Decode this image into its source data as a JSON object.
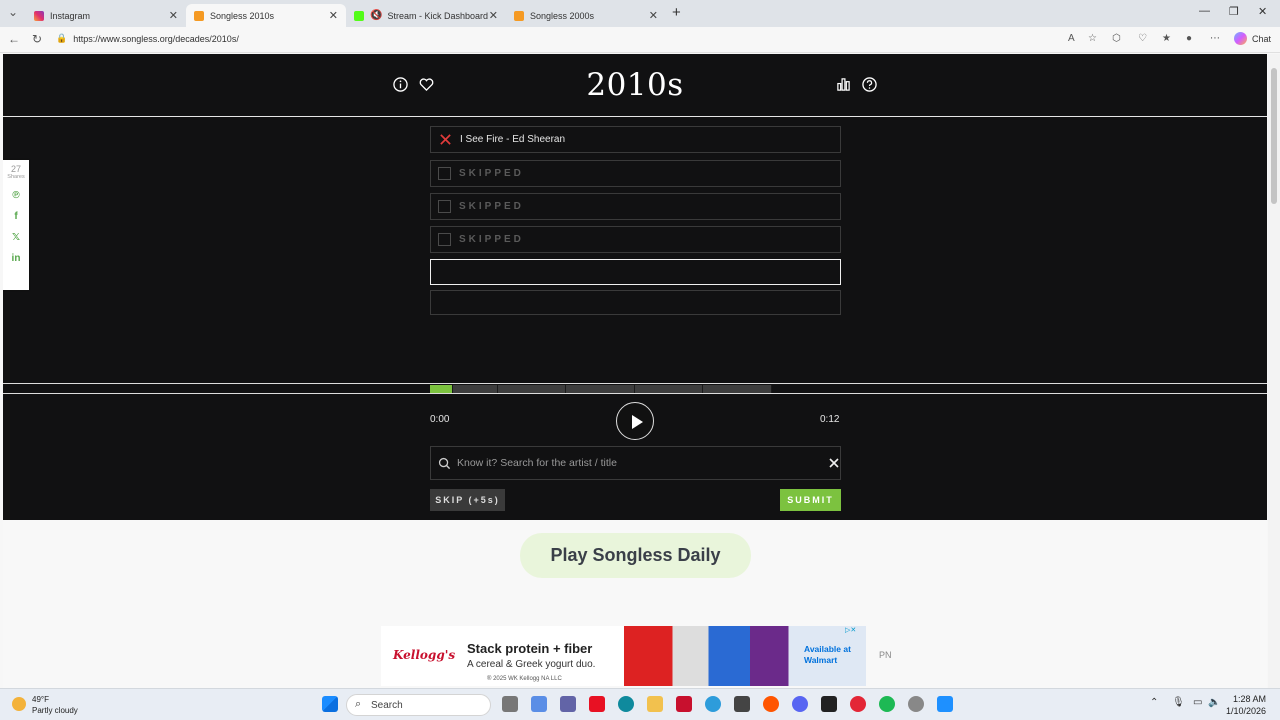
{
  "browser": {
    "tabs": [
      {
        "label": "Instagram",
        "color": "#e1306c"
      },
      {
        "label": "Songless 2010s",
        "color": "#f59a23",
        "active": true
      },
      {
        "label": "Stream - Kick Dashboard",
        "color": "#53fc18"
      },
      {
        "label": "Songless 2000s",
        "color": "#f59a23"
      }
    ],
    "url": "https://www.songless.org/decades/2010s/",
    "chat_label": "Chat"
  },
  "game": {
    "title": "2010s",
    "guesses": [
      {
        "state": "wrong",
        "text": "I See Fire - Ed Sheeran"
      },
      {
        "state": "skip",
        "text": "SKIPPED"
      },
      {
        "state": "skip",
        "text": "SKIPPED"
      },
      {
        "state": "skip",
        "text": "SKIPPED"
      },
      {
        "state": "current",
        "text": ""
      },
      {
        "state": "empty",
        "text": ""
      }
    ],
    "time_start": "0:00",
    "time_end": "0:12",
    "search_placeholder": "Know it? Search for the artist / title",
    "skip_label": "SKIP (+5s)",
    "submit_label": "SUBMIT",
    "accent": "#7cc23f"
  },
  "daily_label": "Play Songless Daily",
  "share": {
    "count": "27",
    "label": "Shares"
  },
  "ad": {
    "brand": "Kellogg's",
    "headline": "Stack protein + fiber",
    "subline": "A cereal & Greek yogurt duo.",
    "copyright": "® 2025 WK Kellogg NA LLC",
    "cta": "Available at Walmart"
  },
  "ad_side_text": "PN",
  "taskbar": {
    "temp": "49°F",
    "weather": "Partly cloudy",
    "search": "Search",
    "time": "1:28 AM",
    "date": "1/10/2026"
  }
}
